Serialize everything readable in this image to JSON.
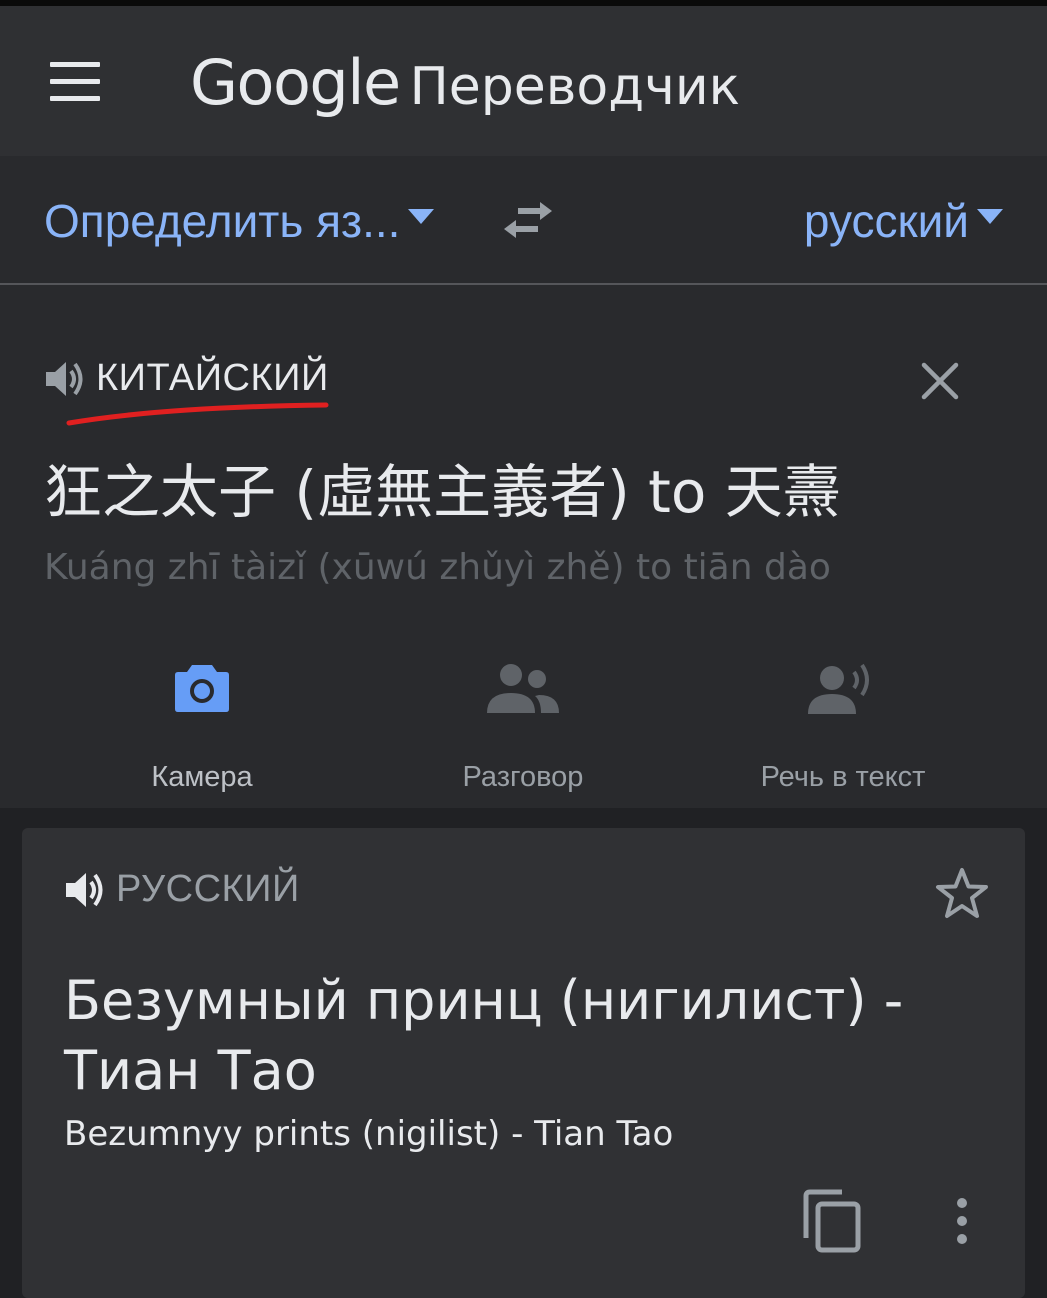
{
  "header": {
    "brand": "Google",
    "product": "Переводчик",
    "menu_icon": "hamburger-menu-icon"
  },
  "language_bar": {
    "source_language": "Определить яз...",
    "target_language": "русский",
    "swap_icon": "swap-arrows-icon"
  },
  "input": {
    "detected_language": "КИТАЙСКИЙ",
    "text": "狂之太子 (虛無主義者) to 天燾",
    "transliteration": "Kuáng zhī tàizǐ (xūwú zhǔyì zhě) to tiān dào",
    "clear_icon": "close-icon"
  },
  "tools": [
    {
      "label": "Камера",
      "icon": "camera-icon"
    },
    {
      "label": "Разговор",
      "icon": "conversation-icon"
    },
    {
      "label": "Речь в текст",
      "icon": "speech-to-text-icon"
    }
  ],
  "result": {
    "language": "РУССКИЙ",
    "text": "Безумный принц (нигилист) - Тиан Тао",
    "transliteration": "Bezumnyy prints (nigilist) - Tian Tao",
    "star_icon": "star-icon",
    "copy_icon": "copy-icon",
    "more_icon": "more-vert-icon"
  },
  "colors": {
    "background": "#202124",
    "app_bar": "#2f3033",
    "accent_blue": "#8ab4f8",
    "camera_blue": "#669df6",
    "annotation_red": "#e02020"
  }
}
